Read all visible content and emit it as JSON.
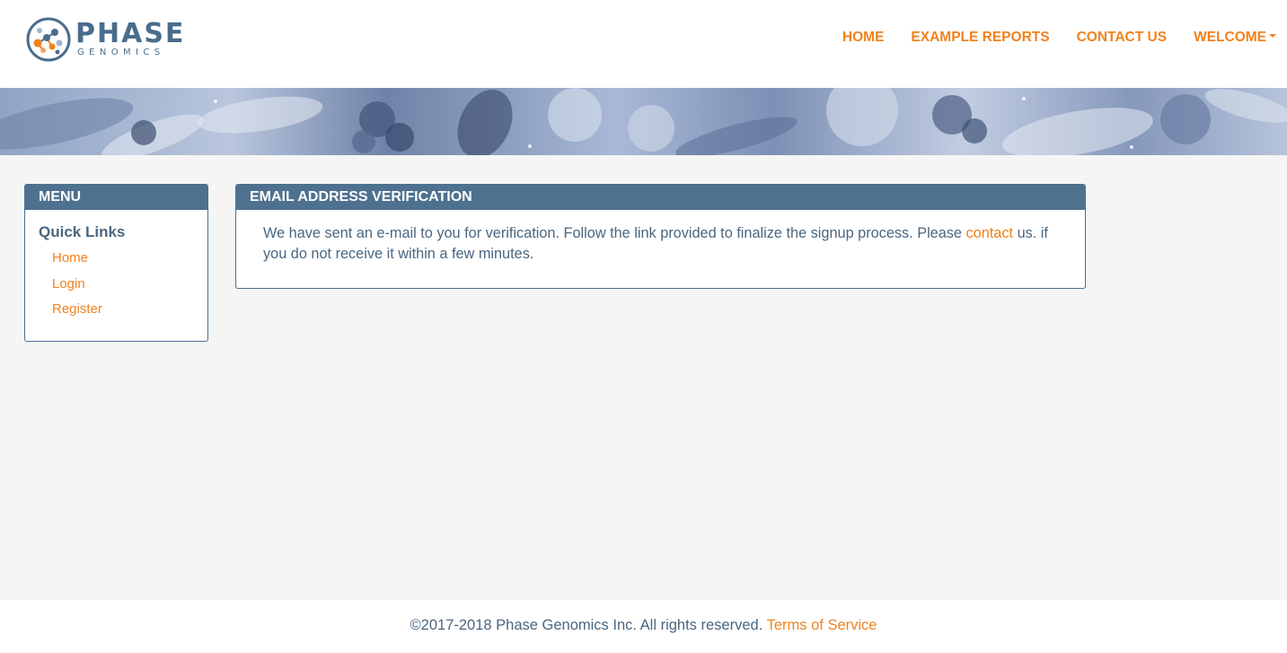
{
  "brand": {
    "name": "PHASE",
    "subtitle": "GENOMICS"
  },
  "nav": {
    "items": [
      {
        "label": "HOME"
      },
      {
        "label": "EXAMPLE REPORTS"
      },
      {
        "label": "CONTACT US"
      },
      {
        "label": "WELCOME"
      }
    ]
  },
  "menu": {
    "title": "MENU",
    "section_title": "Quick Links",
    "links": [
      {
        "label": "Home"
      },
      {
        "label": "Login"
      },
      {
        "label": "Register"
      }
    ]
  },
  "verification": {
    "title": "EMAIL ADDRESS VERIFICATION",
    "text_before": "We have sent an e-mail to you for verification. Follow the link provided to finalize the signup process. Please",
    "link_text": "contact",
    "text_after": "us. if you do not receive it within a few minutes."
  },
  "footer": {
    "copyright": "©2017-2018 Phase Genomics Inc. All rights reserved.",
    "terms_link": "Terms of Service"
  },
  "colors": {
    "accent": "#f0821e",
    "header_bar": "#4f7190",
    "text": "#4a6680",
    "page_bg": "#f5f5f5"
  },
  "icons": {
    "logo": "phase-genomics-logo-icon",
    "dropdown": "caret-down-icon"
  }
}
